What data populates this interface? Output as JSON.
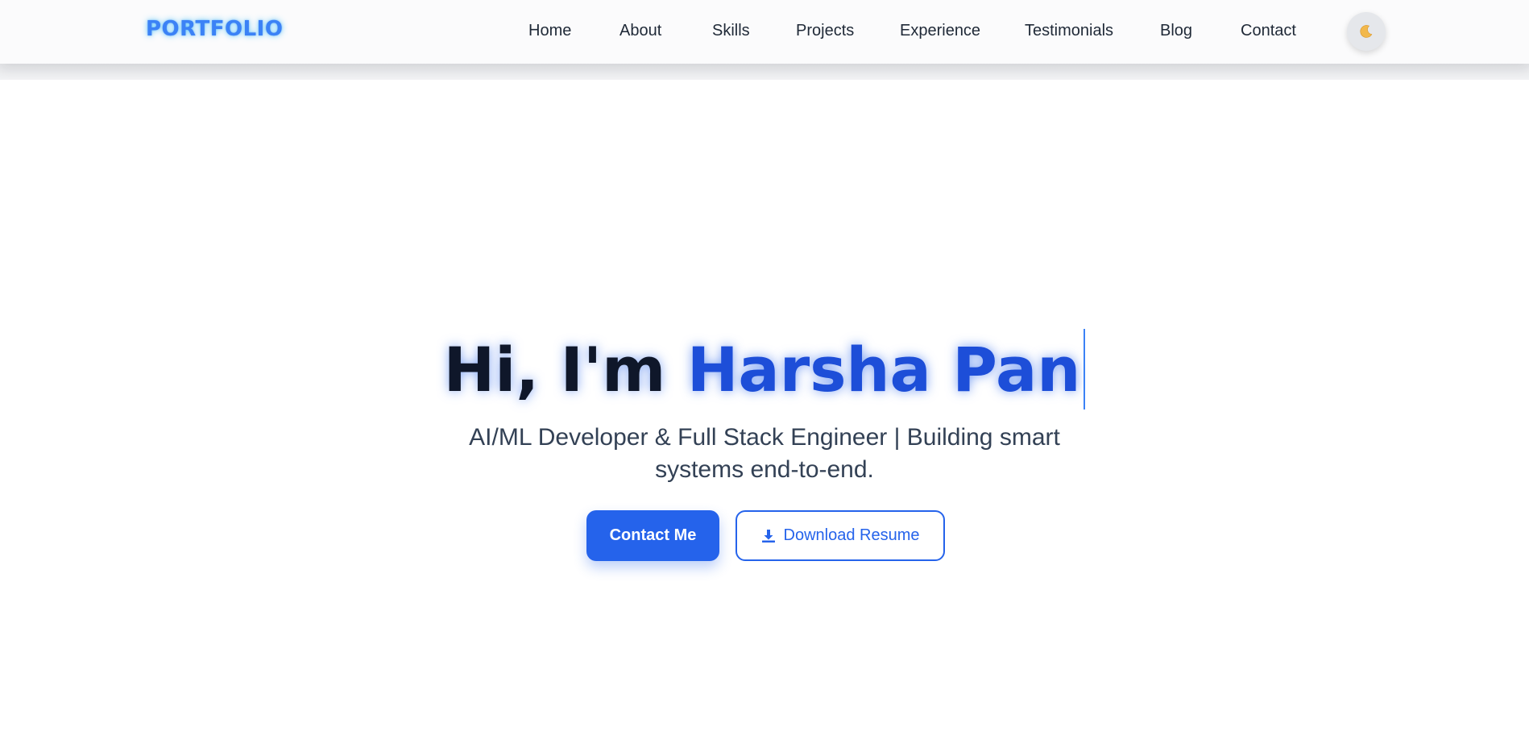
{
  "header": {
    "logo": "PORTFOLIO",
    "nav": [
      {
        "label": "Home"
      },
      {
        "label": "About"
      },
      {
        "label": "Skills"
      },
      {
        "label": "Projects"
      },
      {
        "label": "Experience"
      },
      {
        "label": "Testimonials"
      },
      {
        "label": "Blog"
      },
      {
        "label": "Contact"
      }
    ],
    "theme_toggle_icon": "moon-icon"
  },
  "hero": {
    "title_prefix": "Hi, I'm ",
    "title_name": "Harsha Pan",
    "subtitle": "AI/ML Developer & Full Stack Engineer | Building smart systems end-to-end.",
    "primary_button": "Contact Me",
    "secondary_button": "Download Resume",
    "secondary_button_icon": "download-icon"
  },
  "colors": {
    "accent": "#2563eb",
    "name": "#1d4ed8",
    "logo": "#3b82f6",
    "heading_dark": "#0f172a",
    "nav_text": "#1f2937"
  }
}
